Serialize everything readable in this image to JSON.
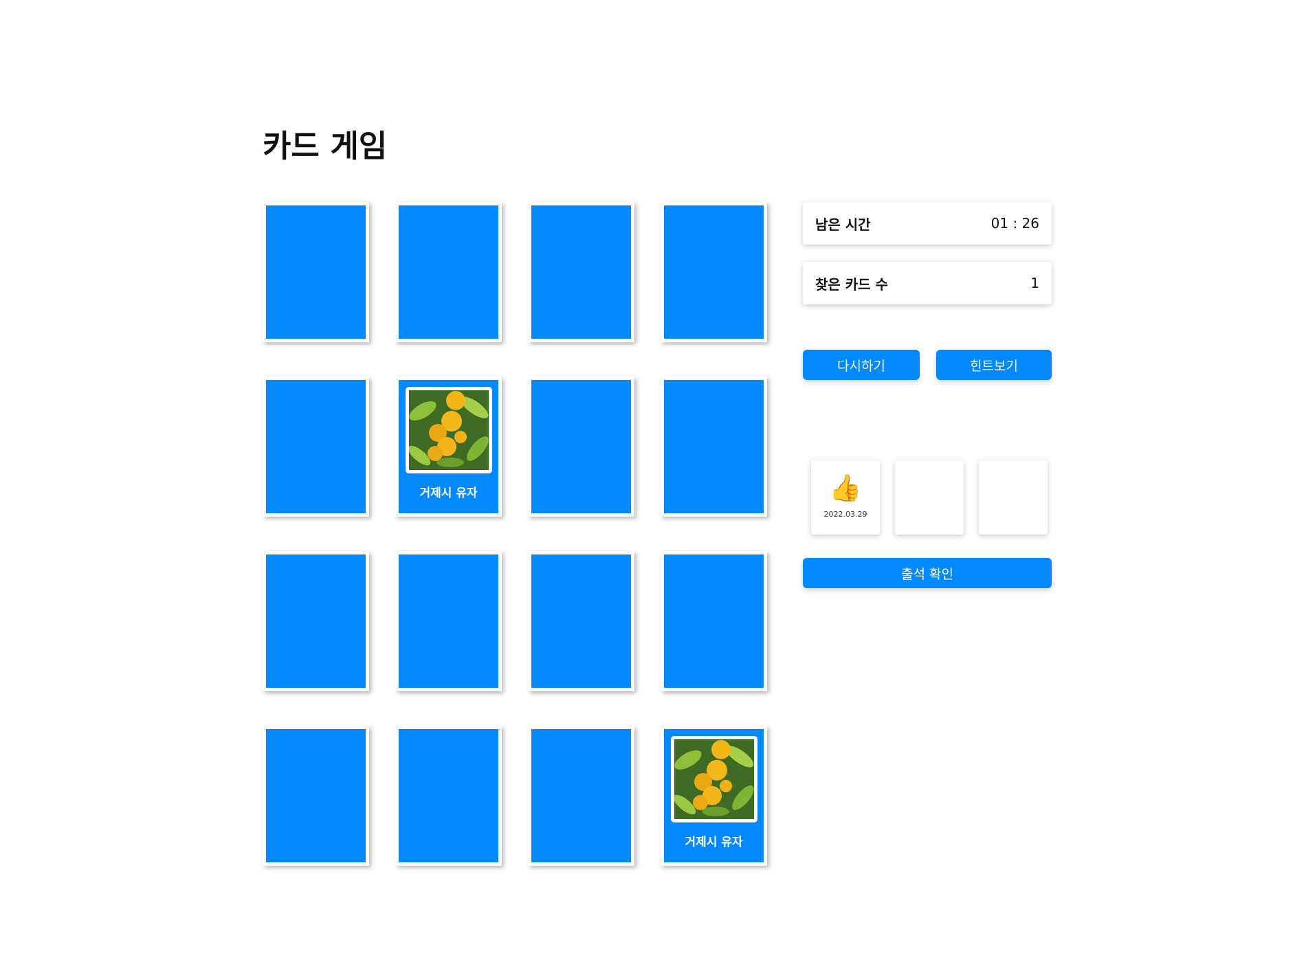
{
  "title": "카드 게임",
  "cards": [
    {
      "open": false
    },
    {
      "open": false
    },
    {
      "open": false
    },
    {
      "open": false
    },
    {
      "open": false
    },
    {
      "open": true,
      "name": "거제시 유자"
    },
    {
      "open": false
    },
    {
      "open": false
    },
    {
      "open": false
    },
    {
      "open": false
    },
    {
      "open": false
    },
    {
      "open": false
    },
    {
      "open": false
    },
    {
      "open": false
    },
    {
      "open": false
    },
    {
      "open": true,
      "name": "거제시 유자"
    }
  ],
  "timer": {
    "label": "남은 시간",
    "value": "01 : 26"
  },
  "found": {
    "label": "찾은 카드 수",
    "value": "1"
  },
  "buttons": {
    "restart": "다시하기",
    "hint": "힌트보기",
    "attendance": "출석 확인"
  },
  "stamps": [
    {
      "icon": "thumbs-up-icon",
      "date": "2022.03.29"
    },
    {
      "icon": "",
      "date": ""
    },
    {
      "icon": "",
      "date": ""
    }
  ],
  "colors": {
    "card_back": "#0389ff",
    "button": "#0389ff"
  }
}
